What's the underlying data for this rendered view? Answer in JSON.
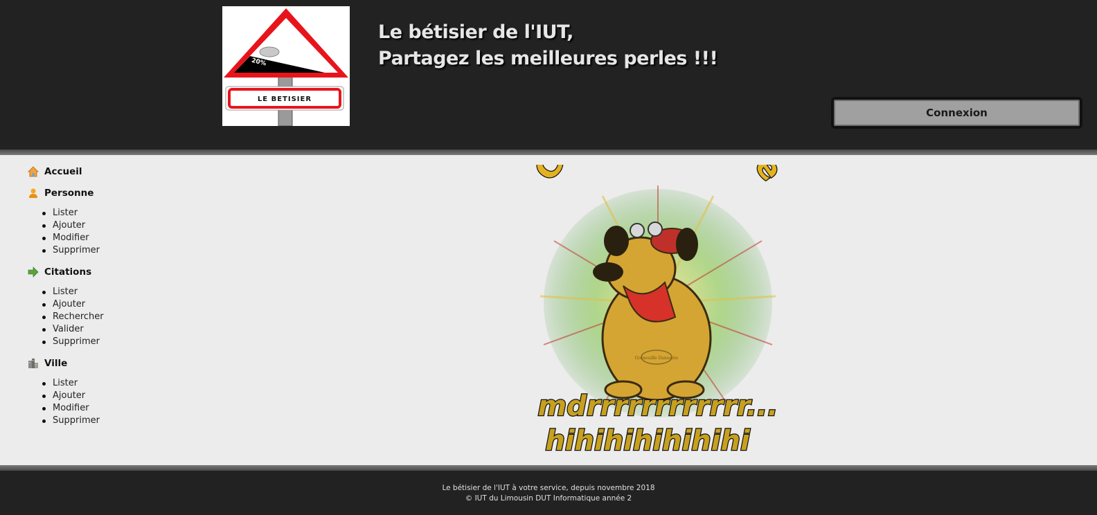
{
  "header": {
    "logo_text": "LE BETISIER",
    "logo_percent": "20%",
    "title_line1": "Le bétisier de l'IUT,",
    "title_line2": "Partagez les meilleures perles !!!",
    "login_label": "Connexion"
  },
  "menu": {
    "accueil": {
      "label": "Accueil",
      "icon": "house-icon"
    },
    "personne": {
      "label": "Personne",
      "icon": "person-icon",
      "items": [
        "Lister",
        "Ajouter",
        "Modifier",
        "Supprimer"
      ]
    },
    "citations": {
      "label": "Citations",
      "icon": "arrow-right-icon",
      "items": [
        "Lister",
        "Ajouter",
        "Rechercher",
        "Valider",
        "Supprimer"
      ]
    },
    "ville": {
      "label": "Ville",
      "icon": "city-icon",
      "items": [
        "Lister",
        "Ajouter",
        "Modifier",
        "Supprimer"
      ]
    }
  },
  "main": {
    "image_top_text": "C pas possible",
    "image_mid_text": "mdrrrrrrrrrrrr...",
    "image_bottom_text": "hihihihihihihi",
    "image_badge": "Grenouille Dansante"
  },
  "footer": {
    "line1": "Le bétisier de l'IUT à votre service, depuis novembre 2018",
    "line2": "© IUT du Limousin DUT Informatique année 2"
  },
  "colors": {
    "header_bg": "#222222",
    "page_bg": "#ececec",
    "button_bg": "#a0a0a0",
    "sign_red": "#e8141c"
  }
}
